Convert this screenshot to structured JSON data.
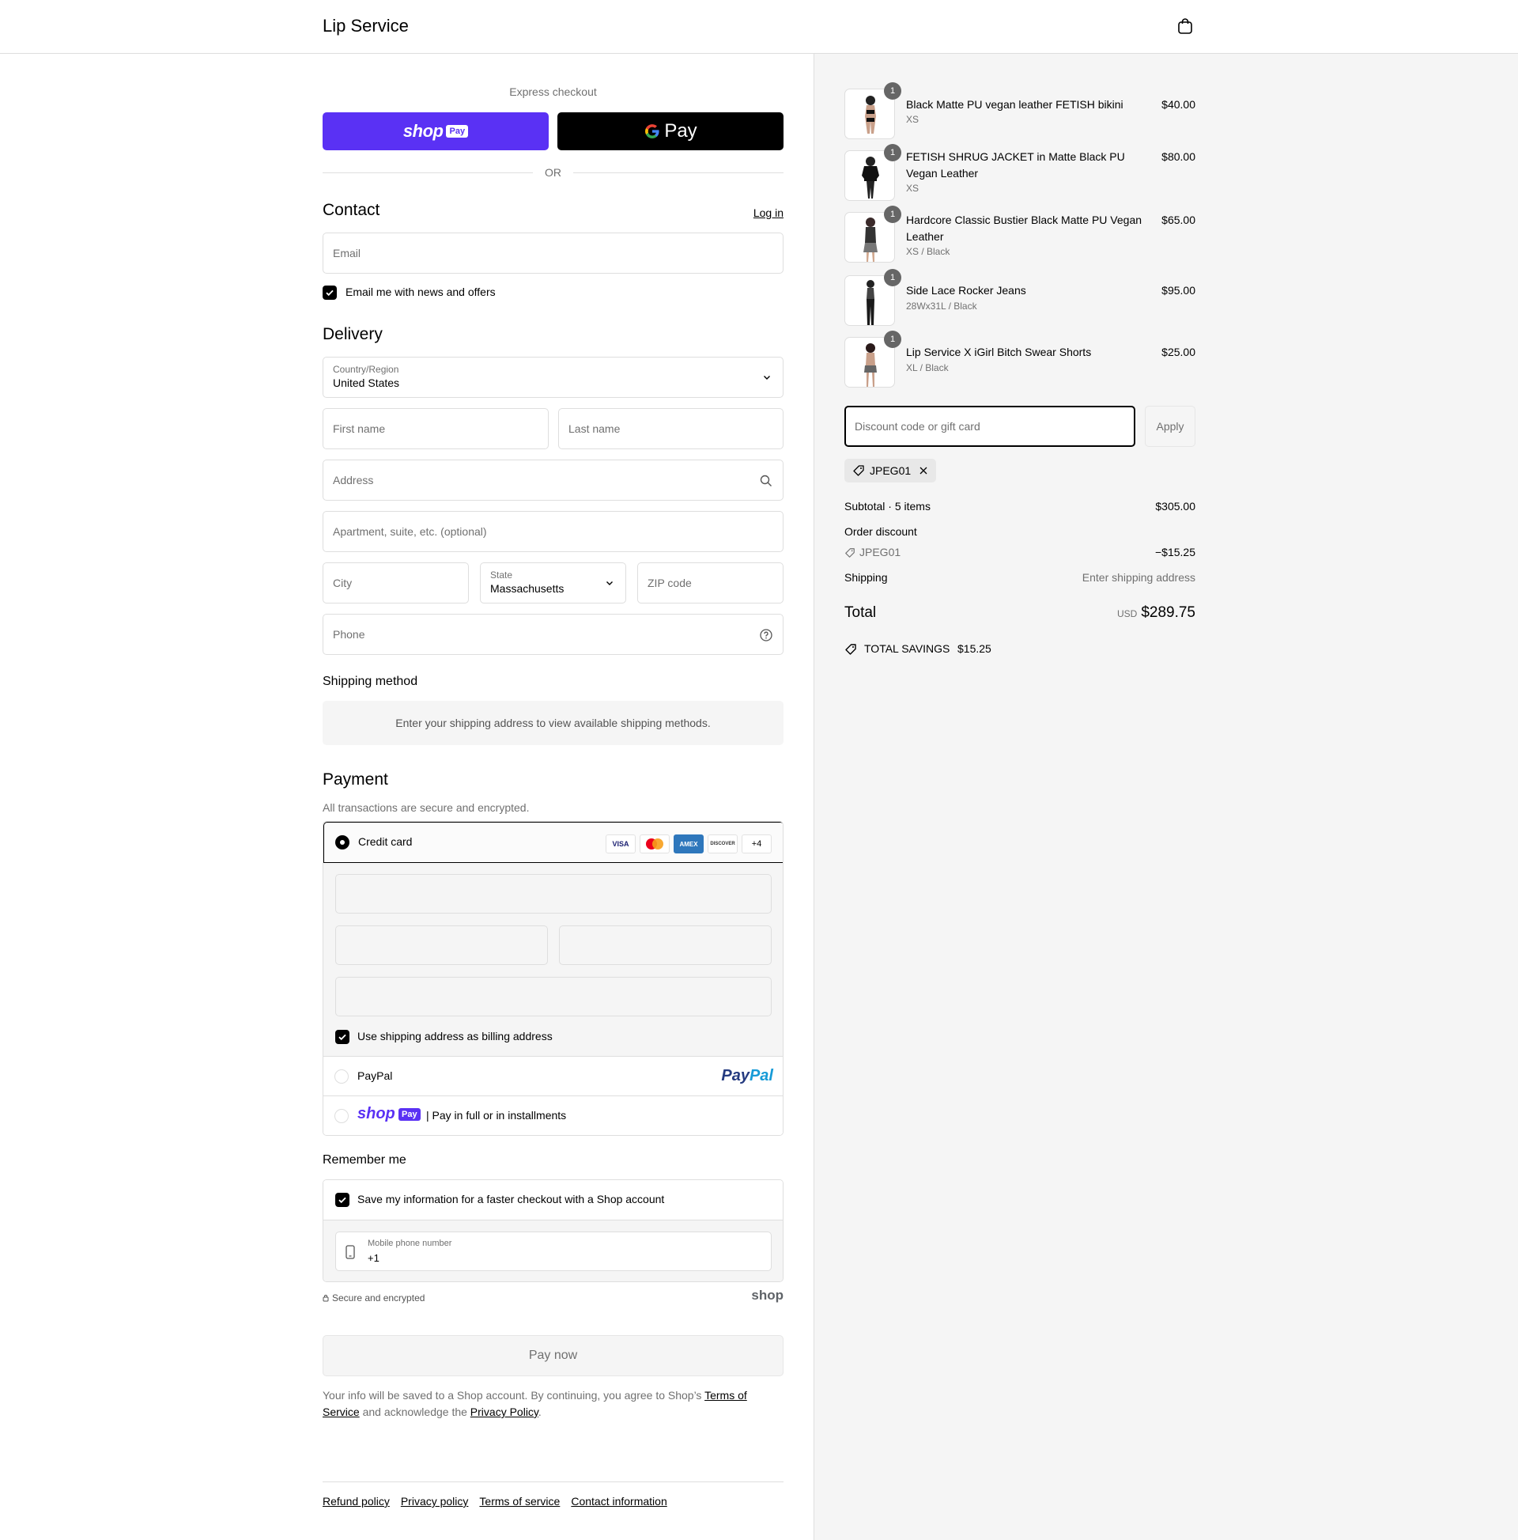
{
  "header": {
    "brand": "Lip Service"
  },
  "express": {
    "title": "Express checkout",
    "shop_pay_word": "shop",
    "shop_pay_pill": "Pay",
    "gpay_label": "Pay",
    "or": "OR"
  },
  "contact": {
    "title": "Contact",
    "login": "Log in",
    "email_placeholder": "Email",
    "news_checkbox": "Email me with news and offers"
  },
  "delivery": {
    "title": "Delivery",
    "country_label": "Country/Region",
    "country_value": "United States",
    "first_name": "First name",
    "last_name": "Last name",
    "address": "Address",
    "apartment": "Apartment, suite, etc. (optional)",
    "city": "City",
    "state_label": "State",
    "state_value": "Massachusetts",
    "zip": "ZIP code",
    "phone": "Phone"
  },
  "shipping_method": {
    "title": "Shipping method",
    "info": "Enter your shipping address to view available shipping methods."
  },
  "payment": {
    "title": "Payment",
    "subtitle": "All transactions are secure and encrypted.",
    "credit_card": "Credit card",
    "card_logos": [
      "VISA",
      "",
      "AMEX",
      "DISCOVER",
      "+4"
    ],
    "billing_checkbox": "Use shipping address as billing address",
    "paypal": "PayPal",
    "paypal_logo_a": "Pay",
    "paypal_logo_b": "Pal",
    "shop_pay_word": "shop",
    "shop_pay_pill": "Pay",
    "shop_pay_text": "| Pay in full or in installments"
  },
  "remember": {
    "title": "Remember me",
    "save_checkbox": "Save my information for a faster checkout with a Shop account",
    "mobile_label": "Mobile phone number",
    "mobile_value": "+1",
    "secure": "Secure and encrypted",
    "shop_mark": "shop"
  },
  "pay_now": "Pay now",
  "legal": {
    "text_a": "Your info will be saved to a Shop account. By continuing, you agree to Shop’s ",
    "terms": "Terms of Service",
    "text_b": " and acknowledge the ",
    "privacy": "Privacy Policy",
    "text_c": "."
  },
  "footer": [
    "Refund policy",
    "Privacy policy",
    "Terms of service",
    "Contact information"
  ],
  "cart": {
    "items": [
      {
        "name": "Black Matte PU vegan leather FETISH bikini",
        "variant": "XS",
        "price": "$40.00",
        "qty": "1"
      },
      {
        "name": "FETISH SHRUG JACKET in Matte Black PU Vegan Leather",
        "variant": "XS",
        "price": "$80.00",
        "qty": "1"
      },
      {
        "name": "Hardcore Classic Bustier Black Matte PU Vegan Leather",
        "variant": "XS / Black",
        "price": "$65.00",
        "qty": "1"
      },
      {
        "name": "Side Lace Rocker Jeans",
        "variant": "28Wx31L / Black",
        "price": "$95.00",
        "qty": "1"
      },
      {
        "name": "Lip Service X iGirl Bitch Swear Shorts",
        "variant": "XL / Black",
        "price": "$25.00",
        "qty": "1"
      }
    ],
    "discount_placeholder": "Discount code or gift card",
    "apply": "Apply",
    "code": "JPEG01",
    "subtotal_label": "Subtotal · 5 items",
    "subtotal_value": "$305.00",
    "order_discount_label": "Order discount",
    "discount_code": "JPEG01",
    "discount_value": "−$15.25",
    "shipping_label": "Shipping",
    "shipping_value": "Enter shipping address",
    "total_label": "Total",
    "currency": "USD",
    "total_value": "$289.75",
    "savings_label": "TOTAL SAVINGS",
    "savings_value": "$15.25"
  },
  "colors": {
    "shop_purple": "#5a31f4",
    "text": "#000000",
    "muted": "#707070",
    "border": "#dedede",
    "side_bg": "#f5f5f5"
  }
}
